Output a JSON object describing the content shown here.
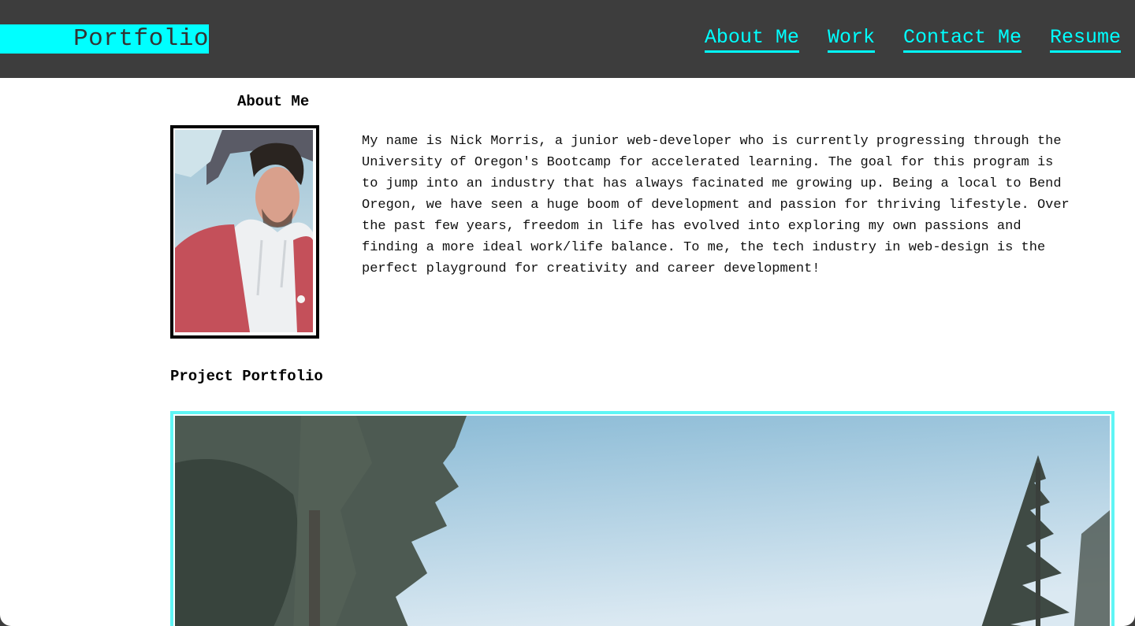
{
  "header": {
    "brand": "Portfolio",
    "nav": [
      {
        "label": "About Me"
      },
      {
        "label": "Work"
      },
      {
        "label": "Contact Me"
      },
      {
        "label": "Resume"
      }
    ]
  },
  "about": {
    "heading": "About Me",
    "bio": "My name is Nick Morris, a junior web-developer who is currently progressing through the University of Oregon's Bootcamp for accelerated learning. The goal for this program is to jump into an industry that has always facinated me growing up. Being a local to Bend Oregon, we have seen a huge boom of development and passion for thriving lifestyle. Over the past few years, freedom in life has evolved into exploring my own passions and finding a more ideal work/life balance. To me, the tech industry in web-design is the perfect playground for creativity and career development!"
  },
  "projects": {
    "heading": "Project Portfolio"
  },
  "colors": {
    "header_bg": "#3d3d3d",
    "accent": "#00ffff",
    "card_border": "#5ff5f5"
  }
}
